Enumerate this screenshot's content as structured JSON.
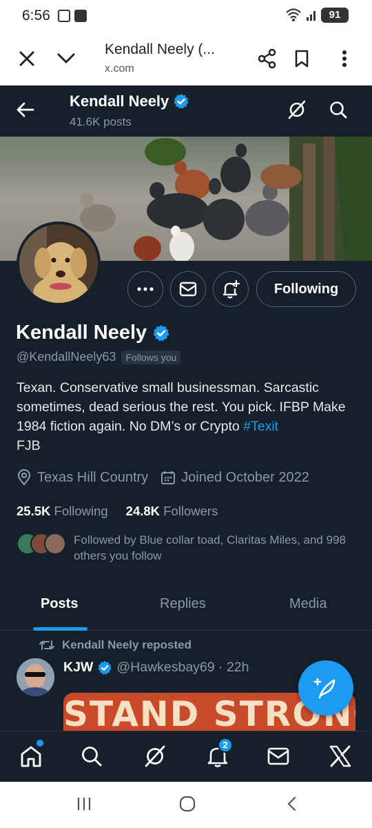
{
  "status_bar": {
    "time": "6:56",
    "battery": "91"
  },
  "browser": {
    "page_title": "Kendall Neely (...",
    "url": "x.com"
  },
  "header": {
    "name": "Kendall Neely",
    "posts_count": "41.6K posts"
  },
  "profile": {
    "name": "Kendall Neely",
    "handle": "@KendallNeely63",
    "follows_you_badge": "Follows you",
    "bio_text": "Texan. Conservative small businessman. Sarcastic sometimes, dead serious the rest. You pick. IFBP Make 1984 fiction again. No DM’s or Crypto ",
    "bio_hashtag": "#Texit",
    "bio_end": "FJB",
    "location": "Texas Hill Country",
    "joined": "Joined October 2022",
    "following_count": "25.5K",
    "following_label": "Following",
    "followers_count": "24.8K",
    "followers_label": "Followers",
    "followed_by": "Followed by Blue collar toad, Claritas Miles, and 998 others you follow",
    "following_button": "Following"
  },
  "tabs": [
    {
      "label": "Posts",
      "active": true
    },
    {
      "label": "Replies",
      "active": false
    },
    {
      "label": "Media",
      "active": false
    }
  ],
  "post": {
    "repost_text": "Kendall Neely reposted",
    "author_name": "KJW",
    "author_handle_time": "@Hawkesbay69 · 22h",
    "image_text": "STAND STRONG"
  },
  "bottom_nav": {
    "notification_count": "2"
  },
  "colors": {
    "accent": "#1d9bf0",
    "background": "#15202b",
    "muted": "#8b98a5"
  },
  "icons": [
    "close-icon",
    "chevron-down-icon",
    "share-icon",
    "bookmark-icon",
    "more-vert-icon",
    "back-arrow-icon",
    "grok-icon",
    "search-icon",
    "more-icon",
    "mail-icon",
    "notification-add-icon",
    "verified-icon",
    "location-icon",
    "calendar-icon",
    "repost-icon",
    "compose-icon",
    "home-icon",
    "bell-icon",
    "x-logo-icon"
  ]
}
